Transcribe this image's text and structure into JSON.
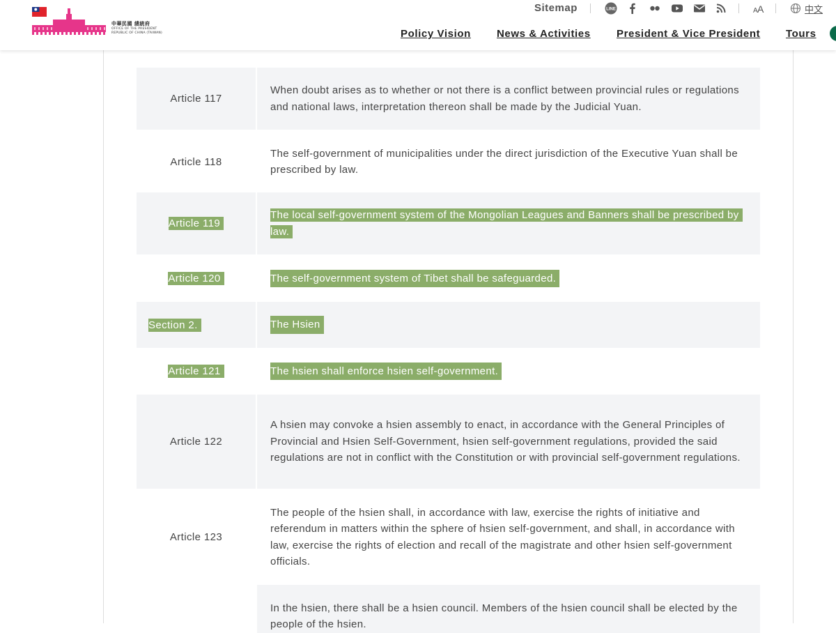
{
  "header": {
    "logo_zh": "中華民國 總統府",
    "logo_en_line1": "OFFICE OF THE PRESIDENT",
    "logo_en_line2": "REPUBLIC OF CHINA (TAIWAN)",
    "flag_icon": "roc-flag-icon",
    "brand_color": "#e6358a"
  },
  "utility": {
    "sitemap": "Sitemap",
    "icons": [
      "line-icon",
      "facebook-icon",
      "flickr-icon",
      "youtube-icon",
      "mail-icon",
      "rss-icon",
      "font-size-icon",
      "globe-icon"
    ],
    "language": "中文"
  },
  "nav": {
    "items": [
      "Policy Vision",
      "News & Activities",
      "President & Vice President",
      "Tours"
    ]
  },
  "colors": {
    "highlight": "#8bad69",
    "row_shade": "#f3f4f6"
  },
  "articles": [
    {
      "label": "Article 117",
      "text": "When doubt arises as to whether or not there is a conflict between provincial rules or regulations and national laws, interpretation thereon shall be made by the Judicial Yuan."
    },
    {
      "label": "Article 118",
      "text": "The self-government of municipalities under the direct jurisdiction of the Executive Yuan shall be prescribed by law."
    },
    {
      "label": "Article 119",
      "text": "The local self-government system of the Mongolian Leagues and Banners shall be prescribed by law."
    },
    {
      "label": "Article 120",
      "text": "The self-government system of Tibet shall be safeguarded."
    },
    {
      "label": "Section 2.",
      "text": "The Hsien"
    },
    {
      "label": "Article 121",
      "text": "The hsien shall enforce hsien self-government."
    },
    {
      "label": "Article 122",
      "text": "A hsien may convoke a hsien assembly to enact, in accordance with the General Principles of Provincial and Hsien Self-Government, hsien self-government regulations, provided the said regulations are not in conflict with the Constitution or with provincial self-government regulations."
    },
    {
      "label": "Article 123",
      "text": "The people of the hsien shall, in accordance with law, exercise the rights of initiative and referendum in matters within the sphere of hsien self-government, and shall, in accordance with law, exercise the rights of election and recall of the magistrate and other hsien self-government officials."
    },
    {
      "label": "",
      "text": "In the hsien, there shall be a hsien council. Members of the hsien council shall be elected by the people of the hsien."
    }
  ]
}
